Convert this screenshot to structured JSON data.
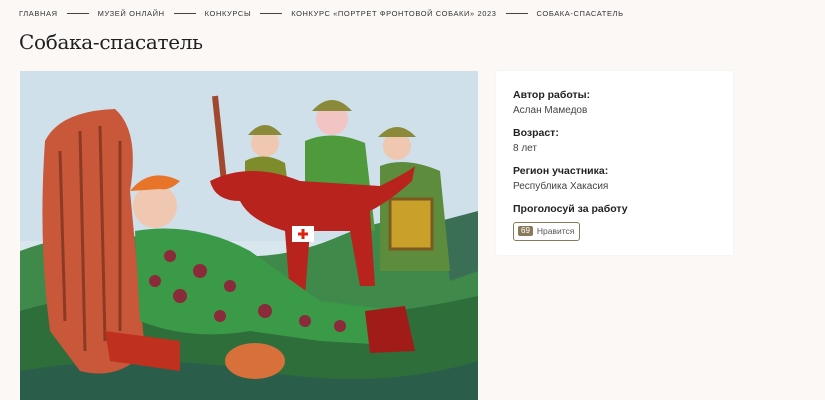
{
  "breadcrumb": [
    {
      "label": "ГЛАВНАЯ"
    },
    {
      "label": "МУЗЕЙ ОНЛАЙН"
    },
    {
      "label": "КОНКУРСЫ"
    },
    {
      "label": "КОНКУРС «ПОРТРЕТ ФРОНТОВОЙ СОБАКИ» 2023"
    },
    {
      "label": "СОБАКА-СПАСАТЕЛЬ"
    }
  ],
  "page": {
    "title": "Собака-спасатель"
  },
  "info": {
    "author_label": "Автор работы",
    "author_value": "Аслан Мамедов",
    "age_label": "Возраст",
    "age_value": "8 лет",
    "region_label": "Регион участника",
    "region_value": "Республика Хакасия",
    "vote_label": "Проголосуй за работу"
  },
  "like": {
    "count": "69",
    "label": "Нравится"
  },
  "colors": {
    "accent": "#8a7a5c",
    "background": "#fbf8f6"
  }
}
